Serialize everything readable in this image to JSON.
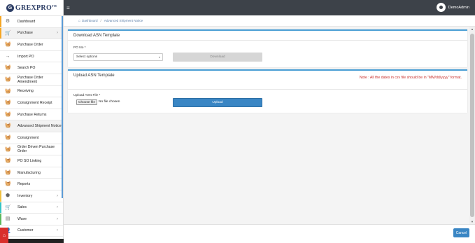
{
  "brand": {
    "initial": "G",
    "name": "GREXPRO",
    "tm": "TM"
  },
  "topbar": {
    "menu_icon": "≡",
    "user_name": "DemoAdmin"
  },
  "breadcrumb": {
    "home": "Dashboard",
    "separator": "/",
    "current": "Advanced Shipment Notice"
  },
  "sidebar": {
    "items": [
      {
        "label": "Dashboard",
        "icon": "⚙",
        "chevron": ""
      },
      {
        "label": "Purchase",
        "icon": "🛒",
        "chevron": "›"
      },
      {
        "label": "Purchase Order",
        "icon": "🧺",
        "chevron": ""
      },
      {
        "label": "Import PO",
        "icon": "→",
        "chevron": ""
      },
      {
        "label": "Search PO",
        "icon": "🧺",
        "chevron": ""
      },
      {
        "label": "Purchase Order Amendment",
        "icon": "🧺",
        "chevron": ""
      },
      {
        "label": "Receiving",
        "icon": "🧺",
        "chevron": ""
      },
      {
        "label": "Consignment Receipt",
        "icon": "🧺",
        "chevron": ""
      },
      {
        "label": "Purchase Returns",
        "icon": "🧺",
        "chevron": ""
      },
      {
        "label": "Advanced Shipment Notice",
        "icon": "🧺",
        "chevron": ""
      },
      {
        "label": "Consignment",
        "icon": "🧺",
        "chevron": ""
      },
      {
        "label": "Order Driven Purchase Order",
        "icon": "🧺",
        "chevron": ""
      },
      {
        "label": "PO SO Linking",
        "icon": "🧺",
        "chevron": ""
      },
      {
        "label": "Manufacturing",
        "icon": "🧺",
        "chevron": ""
      },
      {
        "label": "Reports",
        "icon": "🧺",
        "chevron": ""
      },
      {
        "label": "Inventory",
        "icon": "⬢",
        "chevron": "›"
      },
      {
        "label": "Sales",
        "icon": "🛒",
        "chevron": "›"
      },
      {
        "label": "Wave",
        "icon": "▤",
        "chevron": "›"
      },
      {
        "label": "Customer",
        "icon": "👤",
        "chevron": "›"
      }
    ],
    "home_icon": "⌂"
  },
  "download_card": {
    "title": "Download ASN Template",
    "po_label": "PO No *",
    "select_value": "Select options",
    "download_label": "Download"
  },
  "upload_card": {
    "title": "Upload ASN Template",
    "note": "Note : All the dates in csv file should be in \"MM/dd/yyyy\" format.",
    "file_label": "Upload ASN File *",
    "choose_label": "Choose file",
    "no_file": "No file chosen",
    "upload_label": "Upload"
  },
  "footer": {
    "cancel_label": "Cancel"
  },
  "colors": {
    "accent": "#3a86c4",
    "topbar": "#3d4249",
    "note_red": "#c9302c",
    "home_red": "#d9302c"
  }
}
